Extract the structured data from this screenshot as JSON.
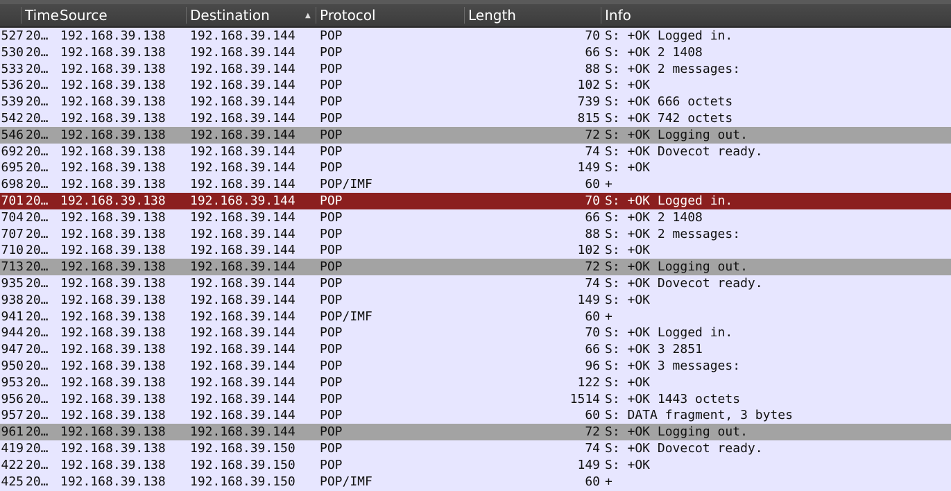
{
  "columns": {
    "time": "Time",
    "source": "Source",
    "destination": "Destination",
    "protocol": "Protocol",
    "length": "Length",
    "info": "Info"
  },
  "sort_icon": "sort-ascending-icon",
  "colors": {
    "row_bg": "#e7e6ff",
    "gray_row": "#a3a3a3",
    "selected_row": "#8b1f1f"
  },
  "packets": [
    {
      "no": "527",
      "time": "20…",
      "src": "192.168.39.138",
      "dst": "192.168.39.144",
      "proto": "POP",
      "len": "70",
      "info": "S: +OK Logged in.",
      "style": ""
    },
    {
      "no": "530",
      "time": "20…",
      "src": "192.168.39.138",
      "dst": "192.168.39.144",
      "proto": "POP",
      "len": "66",
      "info": "S: +OK 2 1408",
      "style": ""
    },
    {
      "no": "533",
      "time": "20…",
      "src": "192.168.39.138",
      "dst": "192.168.39.144",
      "proto": "POP",
      "len": "88",
      "info": "S: +OK 2 messages:",
      "style": ""
    },
    {
      "no": "536",
      "time": "20…",
      "src": "192.168.39.138",
      "dst": "192.168.39.144",
      "proto": "POP",
      "len": "102",
      "info": "S: +OK",
      "style": ""
    },
    {
      "no": "539",
      "time": "20…",
      "src": "192.168.39.138",
      "dst": "192.168.39.144",
      "proto": "POP",
      "len": "739",
      "info": "S: +OK 666 octets",
      "style": ""
    },
    {
      "no": "542",
      "time": "20…",
      "src": "192.168.39.138",
      "dst": "192.168.39.144",
      "proto": "POP",
      "len": "815",
      "info": "S: +OK 742 octets",
      "style": ""
    },
    {
      "no": "546",
      "time": "20…",
      "src": "192.168.39.138",
      "dst": "192.168.39.144",
      "proto": "POP",
      "len": "72",
      "info": "S: +OK Logging out.",
      "style": "gray"
    },
    {
      "no": "692",
      "time": "20…",
      "src": "192.168.39.138",
      "dst": "192.168.39.144",
      "proto": "POP",
      "len": "74",
      "info": "S: +OK Dovecot ready.",
      "style": ""
    },
    {
      "no": "695",
      "time": "20…",
      "src": "192.168.39.138",
      "dst": "192.168.39.144",
      "proto": "POP",
      "len": "149",
      "info": "S: +OK",
      "style": ""
    },
    {
      "no": "698",
      "time": "20…",
      "src": "192.168.39.138",
      "dst": "192.168.39.144",
      "proto": "POP/IMF",
      "len": "60",
      "info": "+",
      "style": ""
    },
    {
      "no": "701",
      "time": "20…",
      "src": "192.168.39.138",
      "dst": "192.168.39.144",
      "proto": "POP",
      "len": "70",
      "info": "S: +OK Logged in.",
      "style": "selected"
    },
    {
      "no": "704",
      "time": "20…",
      "src": "192.168.39.138",
      "dst": "192.168.39.144",
      "proto": "POP",
      "len": "66",
      "info": "S: +OK 2 1408",
      "style": ""
    },
    {
      "no": "707",
      "time": "20…",
      "src": "192.168.39.138",
      "dst": "192.168.39.144",
      "proto": "POP",
      "len": "88",
      "info": "S: +OK 2 messages:",
      "style": ""
    },
    {
      "no": "710",
      "time": "20…",
      "src": "192.168.39.138",
      "dst": "192.168.39.144",
      "proto": "POP",
      "len": "102",
      "info": "S: +OK",
      "style": ""
    },
    {
      "no": "713",
      "time": "20…",
      "src": "192.168.39.138",
      "dst": "192.168.39.144",
      "proto": "POP",
      "len": "72",
      "info": "S: +OK Logging out.",
      "style": "gray"
    },
    {
      "no": "935",
      "time": "20…",
      "src": "192.168.39.138",
      "dst": "192.168.39.144",
      "proto": "POP",
      "len": "74",
      "info": "S: +OK Dovecot ready.",
      "style": ""
    },
    {
      "no": "938",
      "time": "20…",
      "src": "192.168.39.138",
      "dst": "192.168.39.144",
      "proto": "POP",
      "len": "149",
      "info": "S: +OK",
      "style": ""
    },
    {
      "no": "941",
      "time": "20…",
      "src": "192.168.39.138",
      "dst": "192.168.39.144",
      "proto": "POP/IMF",
      "len": "60",
      "info": "+",
      "style": ""
    },
    {
      "no": "944",
      "time": "20…",
      "src": "192.168.39.138",
      "dst": "192.168.39.144",
      "proto": "POP",
      "len": "70",
      "info": "S: +OK Logged in.",
      "style": ""
    },
    {
      "no": "947",
      "time": "20…",
      "src": "192.168.39.138",
      "dst": "192.168.39.144",
      "proto": "POP",
      "len": "66",
      "info": "S: +OK 3 2851",
      "style": ""
    },
    {
      "no": "950",
      "time": "20…",
      "src": "192.168.39.138",
      "dst": "192.168.39.144",
      "proto": "POP",
      "len": "96",
      "info": "S: +OK 3 messages:",
      "style": ""
    },
    {
      "no": "953",
      "time": "20…",
      "src": "192.168.39.138",
      "dst": "192.168.39.144",
      "proto": "POP",
      "len": "122",
      "info": "S: +OK",
      "style": ""
    },
    {
      "no": "956",
      "time": "20…",
      "src": "192.168.39.138",
      "dst": "192.168.39.144",
      "proto": "POP",
      "len": "1514",
      "info": "S: +OK 1443 octets",
      "style": ""
    },
    {
      "no": "957",
      "time": "20…",
      "src": "192.168.39.138",
      "dst": "192.168.39.144",
      "proto": "POP",
      "len": "60",
      "info": "S: DATA fragment, 3 bytes",
      "style": ""
    },
    {
      "no": "961",
      "time": "20…",
      "src": "192.168.39.138",
      "dst": "192.168.39.144",
      "proto": "POP",
      "len": "72",
      "info": "S: +OK Logging out.",
      "style": "gray"
    },
    {
      "no": "419",
      "time": "20…",
      "src": "192.168.39.138",
      "dst": "192.168.39.150",
      "proto": "POP",
      "len": "74",
      "info": "S: +OK Dovecot ready.",
      "style": ""
    },
    {
      "no": "422",
      "time": "20…",
      "src": "192.168.39.138",
      "dst": "192.168.39.150",
      "proto": "POP",
      "len": "149",
      "info": "S: +OK",
      "style": ""
    },
    {
      "no": "425",
      "time": "20…",
      "src": "192.168.39.138",
      "dst": "192.168.39.150",
      "proto": "POP/IMF",
      "len": "60",
      "info": "+",
      "style": ""
    }
  ]
}
